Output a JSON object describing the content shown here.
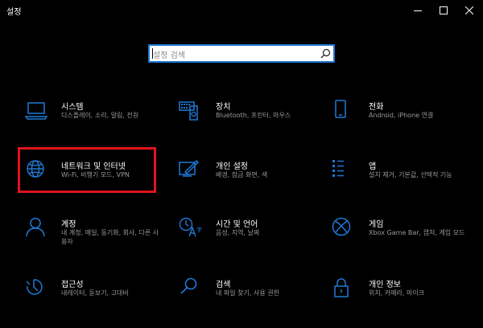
{
  "window": {
    "title": "설정"
  },
  "search": {
    "placeholder": "설정 검색"
  },
  "colors": {
    "accent": "#1e7ad6",
    "highlight": "#e0141e",
    "background": "#000000"
  },
  "tiles": [
    {
      "name": "시스템",
      "desc": "디스플레이, 소리, 알림, 전원",
      "icon": "laptop-icon"
    },
    {
      "name": "장치",
      "desc": "Bluetooth, 프린터, 마우스",
      "icon": "keyboard-device-icon"
    },
    {
      "name": "전화",
      "desc": "Android, iPhone 연결",
      "icon": "phone-icon"
    },
    {
      "name": "네트워크 및 인터넷",
      "desc": "Wi-Fi, 비행기 모드, VPN",
      "icon": "globe-icon"
    },
    {
      "name": "개인 설정",
      "desc": "배경, 잠금 화면, 색",
      "icon": "personalization-icon"
    },
    {
      "name": "앱",
      "desc": "설치 제거, 기본값, 선택적 기능",
      "icon": "apps-list-icon"
    },
    {
      "name": "계정",
      "desc": "내 계정, 메일, 동기화, 회사, 다른 사용자",
      "icon": "person-icon"
    },
    {
      "name": "시간 및 언어",
      "desc": "음성, 지역, 날짜",
      "icon": "time-language-icon"
    },
    {
      "name": "게임",
      "desc": "Xbox Game Bar, 캡처, 게임 모드",
      "icon": "xbox-icon"
    },
    {
      "name": "접근성",
      "desc": "내레이터, 돋보기, 고대비",
      "icon": "accessibility-icon"
    },
    {
      "name": "검색",
      "desc": "내 파일 찾기, 사용 권한",
      "icon": "search-icon"
    },
    {
      "name": "개인 정보",
      "desc": "위치, 카메라, 마이크",
      "icon": "lock-icon"
    }
  ]
}
